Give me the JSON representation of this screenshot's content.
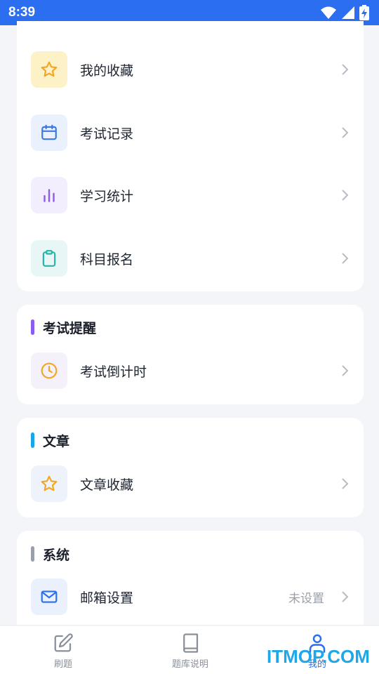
{
  "status_bar": {
    "time": "8:39"
  },
  "menu": {
    "items": [
      {
        "label": "我的收藏",
        "icon": "star-icon",
        "tile_color": "#fdf1c8",
        "icon_color": "#f2a623"
      },
      {
        "label": "考试记录",
        "icon": "calendar-icon",
        "tile_color": "#eaf1fd",
        "icon_color": "#3a78e8"
      },
      {
        "label": "学习统计",
        "icon": "bar-chart-icon",
        "tile_color": "#f2eefd",
        "icon_color": "#8a5cf0"
      },
      {
        "label": "科目报名",
        "icon": "clipboard-icon",
        "tile_color": "#e8f7f5",
        "icon_color": "#23b5a6"
      }
    ]
  },
  "reminder": {
    "title": "考试提醒",
    "accent": "#8a5cf0",
    "items": [
      {
        "label": "考试倒计时",
        "icon": "clock-icon",
        "tile_color": "#f4f1fb",
        "icon_color": "#f2a623"
      }
    ]
  },
  "articles": {
    "title": "文章",
    "accent": "#17a7e8",
    "items": [
      {
        "label": "文章收藏",
        "icon": "star-icon",
        "tile_color": "#eef3fb",
        "icon_color": "#f2a623"
      }
    ]
  },
  "system": {
    "title": "系统",
    "accent": "#9aa0aa",
    "items": [
      {
        "label": "邮箱设置",
        "value": "未设置",
        "icon": "mail-icon",
        "tile_color": "#eaf1fd",
        "icon_color": "#2b6ff0"
      }
    ]
  },
  "tab_bar": {
    "tabs": [
      {
        "label": "刷题",
        "icon": "edit-icon",
        "active": false
      },
      {
        "label": "题库说明",
        "icon": "book-icon",
        "active": false
      },
      {
        "label": "我的",
        "icon": "user-icon",
        "active": true
      }
    ],
    "active_color": "#2b6ff0"
  },
  "watermark": {
    "text_a": "ITMOP",
    "text_b": ".COM"
  }
}
